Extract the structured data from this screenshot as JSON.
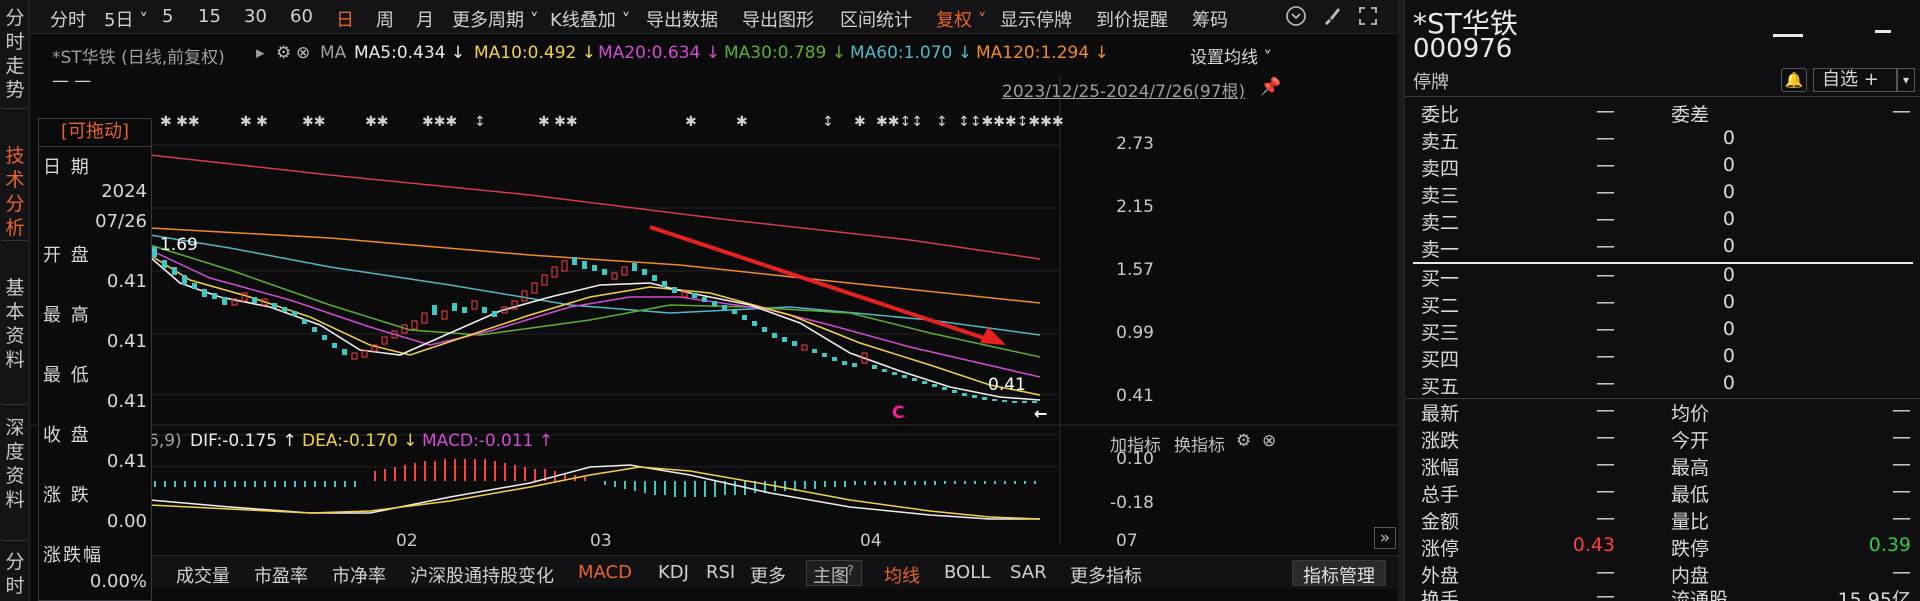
{
  "left_nav": [
    {
      "label": "分时走势",
      "active": false
    },
    {
      "label": "技术分析",
      "active": true
    },
    {
      "label": "基本资料",
      "active": false
    },
    {
      "label": "深度资料",
      "active": false
    },
    {
      "label": "分时",
      "active": false
    }
  ],
  "toolbar": {
    "items": [
      "分时",
      "5日",
      "5",
      "15",
      "30",
      "60",
      "日",
      "周",
      "月",
      "更多周期",
      "K线叠加",
      "导出数据",
      "导出图形",
      "区间统计",
      "复权",
      "显示停牌",
      "到价提醒",
      "筹码"
    ],
    "active_period": "日",
    "fuquan_label": "复权"
  },
  "chart": {
    "symbol_label": "*ST华铁 (日线,前复权)",
    "ma_label": "MA",
    "ma": [
      {
        "text": "MA5:0.434 ↓",
        "color": "#e8e8e8"
      },
      {
        "text": "MA10:0.492 ↓",
        "color": "#f5d142"
      },
      {
        "text": "MA20:0.634 ↓",
        "color": "#d14bd6"
      },
      {
        "text": "MA30:0.789 ↓",
        "color": "#5ab02e"
      },
      {
        "text": "MA60:1.070 ↓",
        "color": "#4fb8c8"
      },
      {
        "text": "MA120:1.294 ↓",
        "color": "#f08a24"
      }
    ],
    "ma_setting": "设置均线",
    "dash_label": "— —",
    "range_label": "2023/12/25-2024/7/26(97根)",
    "y_labels": [
      "2.73",
      "2.15",
      "1.57",
      "0.99",
      "0.41"
    ],
    "max_label": "1.69",
    "min_label": "0.41",
    "c_marker": "C",
    "indicator": {
      "prefix": "6,9)",
      "dif": "DIF:-0.175 ↑",
      "dea": "DEA:-0.170 ↓",
      "macd": "MACD:-0.011 ↑",
      "add": "加指标",
      "switch": "换指标",
      "y_labels": [
        "0.10",
        "-0.18"
      ]
    },
    "x_labels": [
      "02",
      "03",
      "04",
      "07"
    ]
  },
  "info_box": {
    "title": "[可拖动]",
    "rows": [
      {
        "label": "日 期",
        "value": "2024"
      },
      {
        "label": "",
        "value": "07/26"
      },
      {
        "label": "开 盘",
        "value": "0.41"
      },
      {
        "label": "最 高",
        "value": "0.41"
      },
      {
        "label": "最 低",
        "value": "0.41"
      },
      {
        "label": "收 盘",
        "value": "0.41"
      },
      {
        "label": "涨 跌",
        "value": "0.00"
      },
      {
        "label": "涨跌幅",
        "value": "0.00%"
      }
    ]
  },
  "bottom_bar": {
    "items": [
      "成交量",
      "市盈率",
      "市净率",
      "沪深股通持股变化",
      "MACD",
      "KDJ",
      "RSI",
      "更多"
    ],
    "main_label": "主图",
    "main_items": [
      "均线",
      "BOLL",
      "SAR",
      "更多指标"
    ],
    "manage": "指标管理"
  },
  "quote": {
    "name": "*ST华铁",
    "code": "000976",
    "status": "停牌",
    "watch_label": "自选 +",
    "weibi_label": "委比",
    "weibi": "—",
    "weicha_label": "委差",
    "weicha": "—",
    "asks": [
      {
        "label": "卖五",
        "price": "—",
        "vol": "0"
      },
      {
        "label": "卖四",
        "price": "—",
        "vol": "0"
      },
      {
        "label": "卖三",
        "price": "—",
        "vol": "0"
      },
      {
        "label": "卖二",
        "price": "—",
        "vol": "0"
      },
      {
        "label": "卖一",
        "price": "—",
        "vol": "0"
      }
    ],
    "bids": [
      {
        "label": "买一",
        "price": "—",
        "vol": "0"
      },
      {
        "label": "买二",
        "price": "—",
        "vol": "0"
      },
      {
        "label": "买三",
        "price": "—",
        "vol": "0"
      },
      {
        "label": "买四",
        "price": "—",
        "vol": "0"
      },
      {
        "label": "买五",
        "price": "—",
        "vol": "0"
      }
    ],
    "stats": [
      {
        "l1": "最新",
        "v1": "—",
        "l2": "均价",
        "v2": "—"
      },
      {
        "l1": "涨跌",
        "v1": "—",
        "l2": "今开",
        "v2": "—"
      },
      {
        "l1": "涨幅",
        "v1": "—",
        "l2": "最高",
        "v2": "—"
      },
      {
        "l1": "总手",
        "v1": "—",
        "l2": "最低",
        "v2": "—"
      },
      {
        "l1": "金额",
        "v1": "—",
        "l2": "量比",
        "v2": "—"
      },
      {
        "l1": "涨停",
        "v1": "0.43",
        "l2": "跌停",
        "v2": "0.39"
      },
      {
        "l1": "外盘",
        "v1": "—",
        "l2": "内盘",
        "v2": "—"
      },
      {
        "l1": "换手",
        "v1": "—",
        "l2": "流通股",
        "v2": "15.95亿"
      }
    ]
  }
}
